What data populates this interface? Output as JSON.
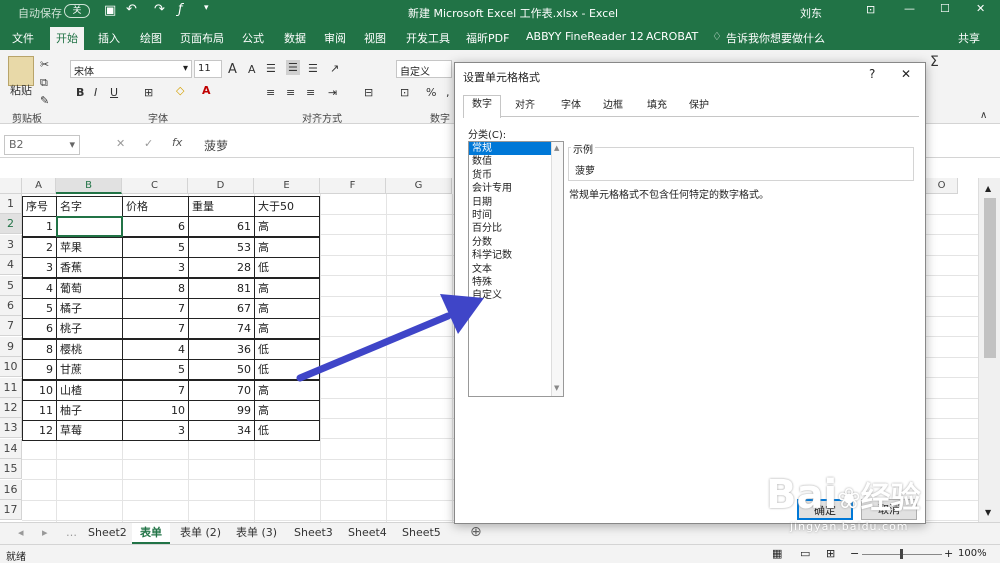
{
  "titlebar": {
    "autosave": "自动保存",
    "autosave_state": "关",
    "title": "新建 Microsoft Excel 工作表.xlsx - Excel",
    "user": "刘东"
  },
  "ribbon_tabs": [
    "文件",
    "开始",
    "插入",
    "绘图",
    "页面布局",
    "公式",
    "数据",
    "审阅",
    "视图",
    "开发工具",
    "福昕PDF",
    "ABBYY FineReader 12",
    "ACROBAT"
  ],
  "tell_me": "告诉我你想要做什么",
  "share": "共享",
  "ribbon": {
    "paste": "粘贴",
    "clipboard": "剪贴板",
    "font_name": "宋体",
    "font_size": "11",
    "font_group": "字体",
    "align_group": "对齐方式",
    "number_format": "自定义",
    "number_group": "数字",
    "bold": "B",
    "italic": "I",
    "underline": "U",
    "grow_font": "A",
    "shrink_font": "A",
    "fill_color": "◇",
    "font_color": "A",
    "percent": "%",
    "comma": ","
  },
  "formula_bar": {
    "name_box": "B2",
    "fx": "fx",
    "content": "菠萝"
  },
  "columns": [
    "A",
    "B",
    "C",
    "D",
    "E",
    "F",
    "G",
    "O"
  ],
  "rows": [
    "1",
    "2",
    "3",
    "4",
    "5",
    "6",
    "7",
    "9",
    "10",
    "11",
    "12",
    "13",
    "14",
    "15",
    "16",
    "17"
  ],
  "table": {
    "headers": [
      "序号",
      "名字",
      "价格",
      "重量",
      "大于50"
    ],
    "rows": [
      [
        "1",
        "",
        "6",
        "61",
        "高"
      ],
      [
        "2",
        "苹果",
        "5",
        "53",
        "高"
      ],
      [
        "3",
        "香蕉",
        "3",
        "28",
        "低"
      ],
      [
        "4",
        "葡萄",
        "8",
        "81",
        "高"
      ],
      [
        "5",
        "橘子",
        "7",
        "67",
        "高"
      ],
      [
        "6",
        "桃子",
        "7",
        "74",
        "高"
      ],
      [
        "8",
        "樱桃",
        "4",
        "36",
        "低"
      ],
      [
        "9",
        "甘蔗",
        "5",
        "50",
        "低"
      ],
      [
        "10",
        "山楂",
        "7",
        "70",
        "高"
      ],
      [
        "11",
        "柚子",
        "10",
        "99",
        "高"
      ],
      [
        "12",
        "草莓",
        "3",
        "34",
        "低"
      ]
    ]
  },
  "sheet_tabs": [
    "Sheet2",
    "表单",
    "表单 (2)",
    "表单 (3)",
    "Sheet3",
    "Sheet4",
    "Sheet5"
  ],
  "active_sheet": "表单",
  "status": {
    "left": "就绪",
    "zoom": "100%"
  },
  "dialog": {
    "title": "设置单元格格式",
    "help": "?",
    "close": "✕",
    "tabs": [
      "数字",
      "对齐",
      "字体",
      "边框",
      "填充",
      "保护"
    ],
    "category_label": "分类(C):",
    "categories": [
      "常规",
      "数值",
      "货币",
      "会计专用",
      "日期",
      "时间",
      "百分比",
      "分数",
      "科学记数",
      "文本",
      "特殊",
      "自定义"
    ],
    "selected": "常规",
    "sample_label": "示例",
    "sample_value": "菠萝",
    "description": "常规单元格格式不包含任何特定的数字格式。",
    "ok": "确定",
    "cancel": "取消"
  },
  "watermark": {
    "brand": "Bai",
    "brand_cn": "经验",
    "url": "jingyan.baidu.com"
  },
  "colors": {
    "excel_green": "#217346",
    "arrow": "#3f45c8",
    "selection": "#0078d7"
  }
}
